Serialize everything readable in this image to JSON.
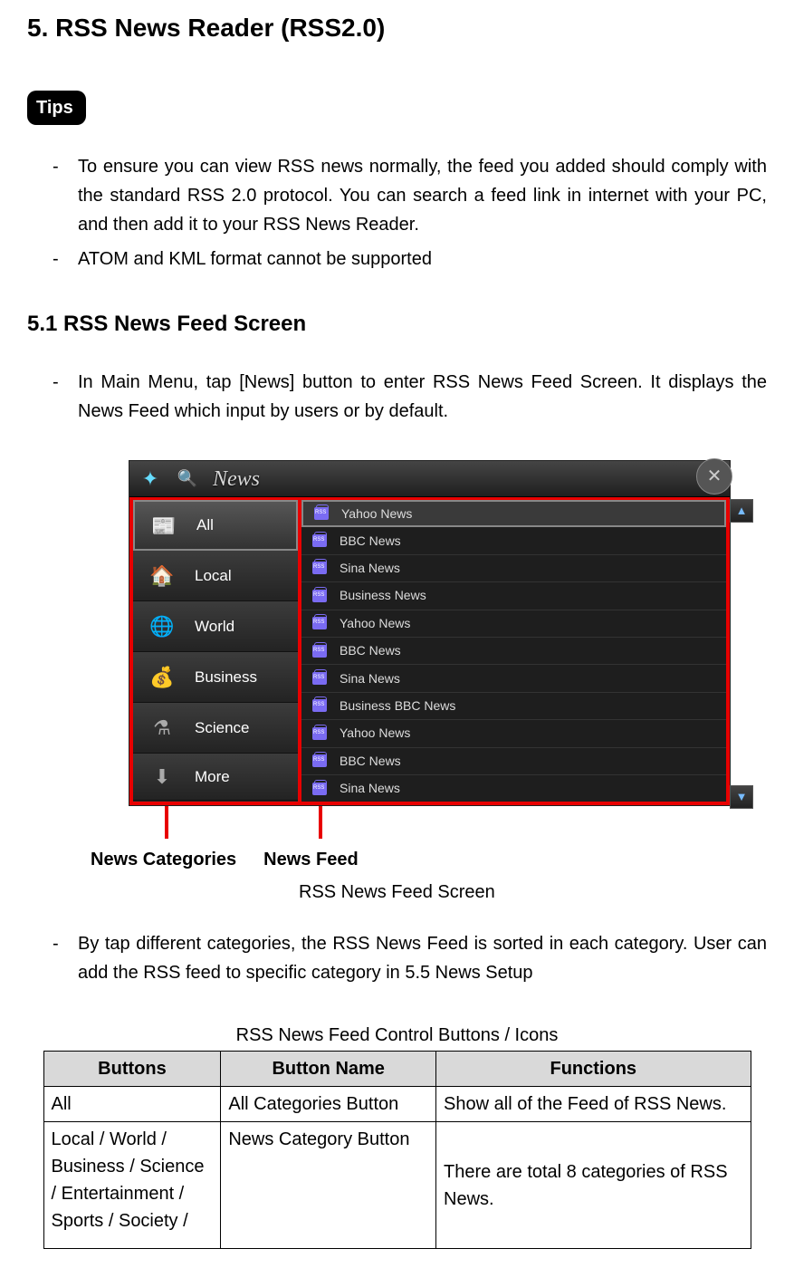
{
  "heading": "5. RSS News Reader (RSS2.0)",
  "tips_label": "Tips",
  "tips": [
    "To ensure you can view RSS news normally, the feed you added should comply with the standard RSS 2.0 protocol. You can search a feed link in internet with your PC, and then add it to your RSS News Reader.",
    "ATOM and KML format cannot be supported"
  ],
  "subheading": "5.1 RSS News Feed Screen",
  "intro": "In Main Menu, tap [News] button to enter RSS News Feed Screen. It displays the News Feed which input by users or by default.",
  "screenshot": {
    "title": "News",
    "categories": [
      {
        "label": "All",
        "icon": "newspaper"
      },
      {
        "label": "Local",
        "icon": "house"
      },
      {
        "label": "World",
        "icon": "globe"
      },
      {
        "label": "Business",
        "icon": "coins"
      },
      {
        "label": "Science",
        "icon": "flask"
      },
      {
        "label": "More",
        "icon": "arrow-down"
      }
    ],
    "feeds": [
      "Yahoo News",
      "BBC News",
      "Sina News",
      "Business News",
      "Yahoo News",
      "BBC News",
      "Sina News",
      "Business  BBC News",
      "Yahoo News",
      "BBC News",
      "Sina News"
    ]
  },
  "anno": {
    "categories": "News Categories",
    "feed": "News Feed"
  },
  "caption": "RSS News Feed Screen",
  "outro": "By tap different categories, the RSS News Feed is sorted in each category. User can add the RSS feed to specific category in 5.5 News Setup",
  "table_caption": "RSS News Feed Control Buttons / Icons",
  "table": {
    "headers": [
      "Buttons",
      "Button Name",
      "Functions"
    ],
    "rows": [
      {
        "buttons": "All",
        "name": "All Categories Button",
        "func": "Show all of the Feed of RSS News."
      },
      {
        "buttons": "Local / World / Business / Science / Entertainment / Sports / Society /",
        "name": "News Category Button",
        "func": "There are total 8 categories of RSS News."
      }
    ]
  }
}
